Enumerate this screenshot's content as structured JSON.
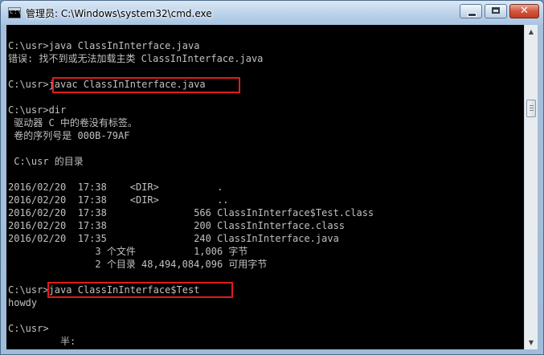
{
  "window": {
    "title": "管理员: C:\\Windows\\system32\\cmd.exe",
    "icon_label": "C:\\",
    "close_glyph": "✕"
  },
  "console": {
    "lines": [
      "",
      "C:\\usr>java ClassInInterface.java",
      "错误: 找不到或无法加载主类 ClassInInterface.java",
      "",
      "C:\\usr>javac ClassInInterface.java",
      "",
      "C:\\usr>dir",
      " 驱动器 C 中的卷没有标签。",
      " 卷的序列号是 000B-79AF",
      "",
      " C:\\usr 的目录",
      "",
      "2016/02/20  17:38    <DIR>          .",
      "2016/02/20  17:38    <DIR>          ..",
      "2016/02/20  17:38               566 ClassInInterface$Test.class",
      "2016/02/20  17:38               200 ClassInInterface.class",
      "2016/02/20  17:35               240 ClassInInterface.java",
      "               3 个文件          1,006 字节",
      "               2 个目录 48,494,084,096 可用字节",
      "",
      "C:\\usr>java ClassInInterface$Test",
      "howdy",
      "",
      "C:\\usr>",
      "         半:"
    ]
  },
  "colors": {
    "console_bg": "#000000",
    "console_fg": "#c0c0c0",
    "highlight": "#e21b1b"
  },
  "scrollbar": {
    "up_icon": "▲",
    "down_icon": "▼"
  }
}
